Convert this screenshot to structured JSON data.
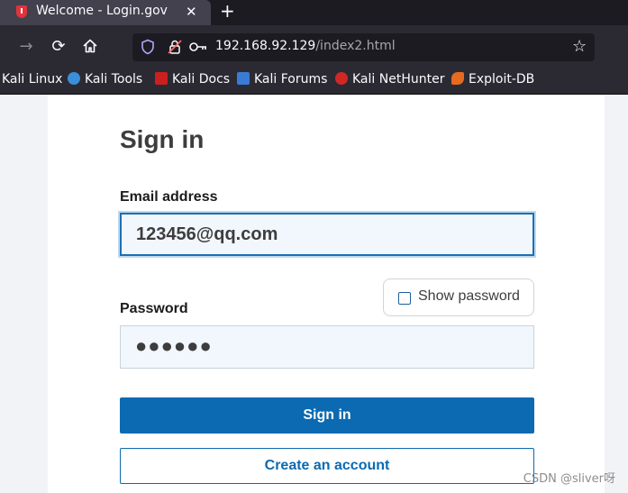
{
  "browser": {
    "tab_title": "Welcome - Login.gov",
    "tab_close": "✕",
    "new_tab": "+",
    "url_host": "192.168.92.129",
    "url_path": "/index2.html",
    "bookmarks": [
      {
        "label": "Kali Linux",
        "icon_color": ""
      },
      {
        "label": "Kali Tools",
        "icon_color": "#3b8fd8"
      },
      {
        "label": "Kali Docs",
        "icon_color": "#cc1f1f"
      },
      {
        "label": "Kali Forums",
        "icon_color": "#3a7bd5"
      },
      {
        "label": "Kali NetHunter",
        "icon_color": "#d22727"
      },
      {
        "label": "Exploit-DB",
        "icon_color": "#e76a21"
      }
    ]
  },
  "form": {
    "title": "Sign in",
    "email_label": "Email address",
    "email_value": "123456@qq.com",
    "password_label": "Password",
    "password_value": "●●●●●●",
    "show_password_label": "Show password",
    "show_password_checked": false,
    "signin_label": "Sign in",
    "create_account_label": "Create an account"
  },
  "watermark": "CSDN @sliver呀",
  "colors": {
    "primary": "#0b6ab1",
    "field_bg": "#f1f7fd",
    "chrome_dark": "#1c1b22",
    "chrome": "#2b2a33"
  }
}
